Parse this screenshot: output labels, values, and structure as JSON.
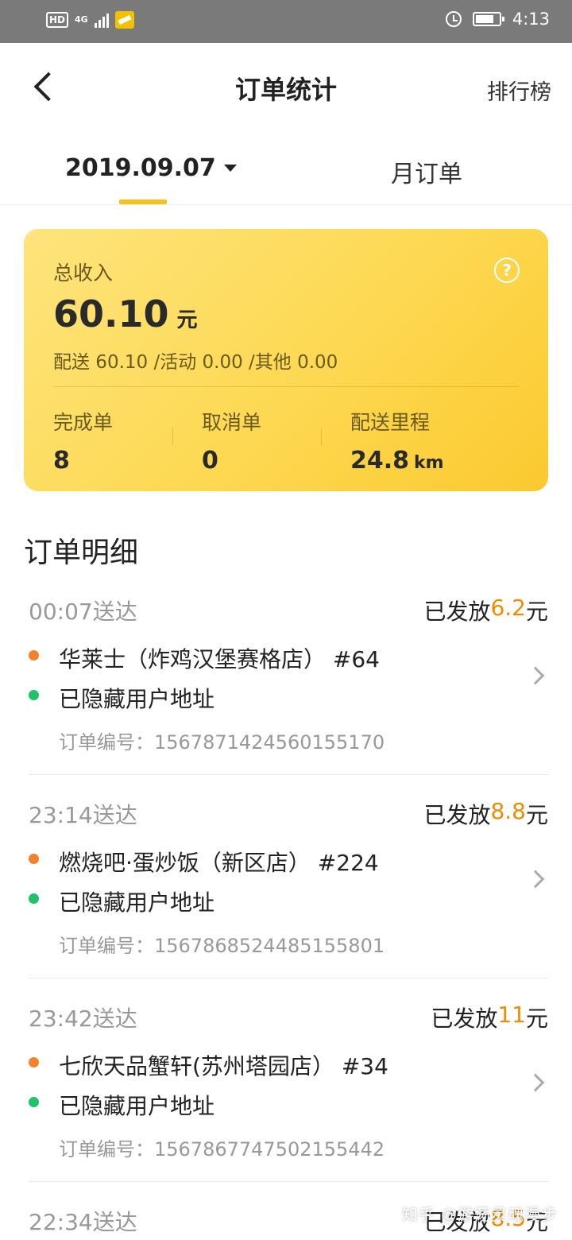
{
  "status_bar": {
    "hd": "HD",
    "network": "4G",
    "time": "4:13"
  },
  "nav": {
    "title": "订单统计",
    "rank": "排行榜"
  },
  "tabs": {
    "date": "2019.09.07",
    "month": "月订单"
  },
  "summary": {
    "label": "总收入",
    "help": "?",
    "income": "60.10",
    "income_unit": "元",
    "breakdown": "配送 60.10 /活动 0.00 /其他 0.00",
    "stats": [
      {
        "label": "完成单",
        "value": "8",
        "unit": ""
      },
      {
        "label": "取消单",
        "value": "0",
        "unit": ""
      },
      {
        "label": "配送里程",
        "value": "24.8",
        "unit": "km"
      }
    ]
  },
  "detail": {
    "title": "订单明细",
    "paid_prefix": "已发放",
    "currency": "元",
    "orders": [
      {
        "time": "00:07送达",
        "amount": "6.2",
        "shop": "华莱士（炸鸡汉堡赛格店） #64",
        "address": "已隐藏用户地址",
        "number": "订单编号：1567871424560155170"
      },
      {
        "time": "23:14送达",
        "amount": "8.8",
        "shop": "燃烧吧·蛋炒饭（新区店） #224",
        "address": "已隐藏用户地址",
        "number": "订单编号：1567868524485155801"
      },
      {
        "time": "23:42送达",
        "amount": "11",
        "shop": "七欣天品蟹轩(苏州塔园店） #34",
        "address": "已隐藏用户地址",
        "number": "订单编号：1567867747502155442"
      },
      {
        "time": "22:34送达",
        "amount": "8.5",
        "shop": "",
        "address": "",
        "number": ""
      }
    ]
  },
  "watermark": "知乎 @游荡灵魂漫步",
  "colors": {
    "accent_yellow": "#f7c21b",
    "amount_orange": "#f08c00",
    "shop_dot": "#f5822a",
    "addr_dot": "#1fc16b"
  }
}
